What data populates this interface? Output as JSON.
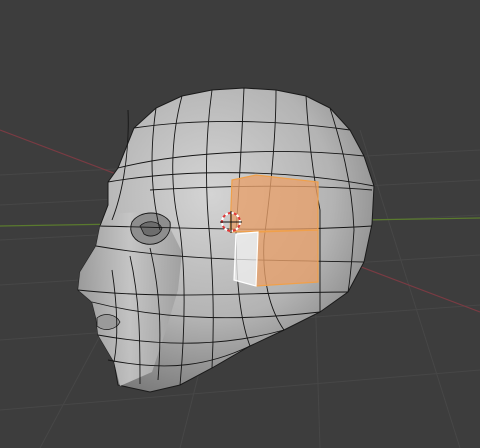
{
  "viewport": {
    "name": "3d-viewport",
    "shading": "solid",
    "mesh_object": "head-mesh",
    "selection_mode": "face",
    "selected_faces": 2,
    "overlay": {
      "grid": true,
      "axis_x": true,
      "axis_y": true
    },
    "colors": {
      "background": "#3d3d3d",
      "grid": "#474747",
      "axis_x": "#7a3b43",
      "axis_y": "#5a7a2e",
      "mesh_light": "#c9c9c9",
      "mesh_mid": "#a6a6a6",
      "mesh_dark": "#6b6b6b",
      "wire": "#151515",
      "selected_face": "#e8a06a",
      "active_face": "#f2f2f2",
      "cursor_ring_a": "#e03a3a",
      "cursor_ring_b": "#ffffff"
    }
  }
}
